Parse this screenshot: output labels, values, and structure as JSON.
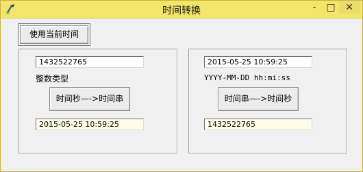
{
  "window": {
    "title": "时间转换"
  },
  "titlebar_buttons": {
    "minimize": "-",
    "maximize": "□",
    "close": "✕"
  },
  "toolbar": {
    "use_current_label": "使用当前时间"
  },
  "left_panel": {
    "timestamp_value": "1432522765",
    "type_label": "整数类型",
    "convert_label": "时间秒—->时间串",
    "result_value": "2015-05-25 10:59:25"
  },
  "right_panel": {
    "datetime_value": "2015-05-25 10:59:25",
    "format_label": "YYYY-MM-DD hh:mi:ss",
    "convert_label": "时间串—->时间秒",
    "result_value": "1432522765"
  },
  "icons": {
    "app": "app-icon"
  }
}
